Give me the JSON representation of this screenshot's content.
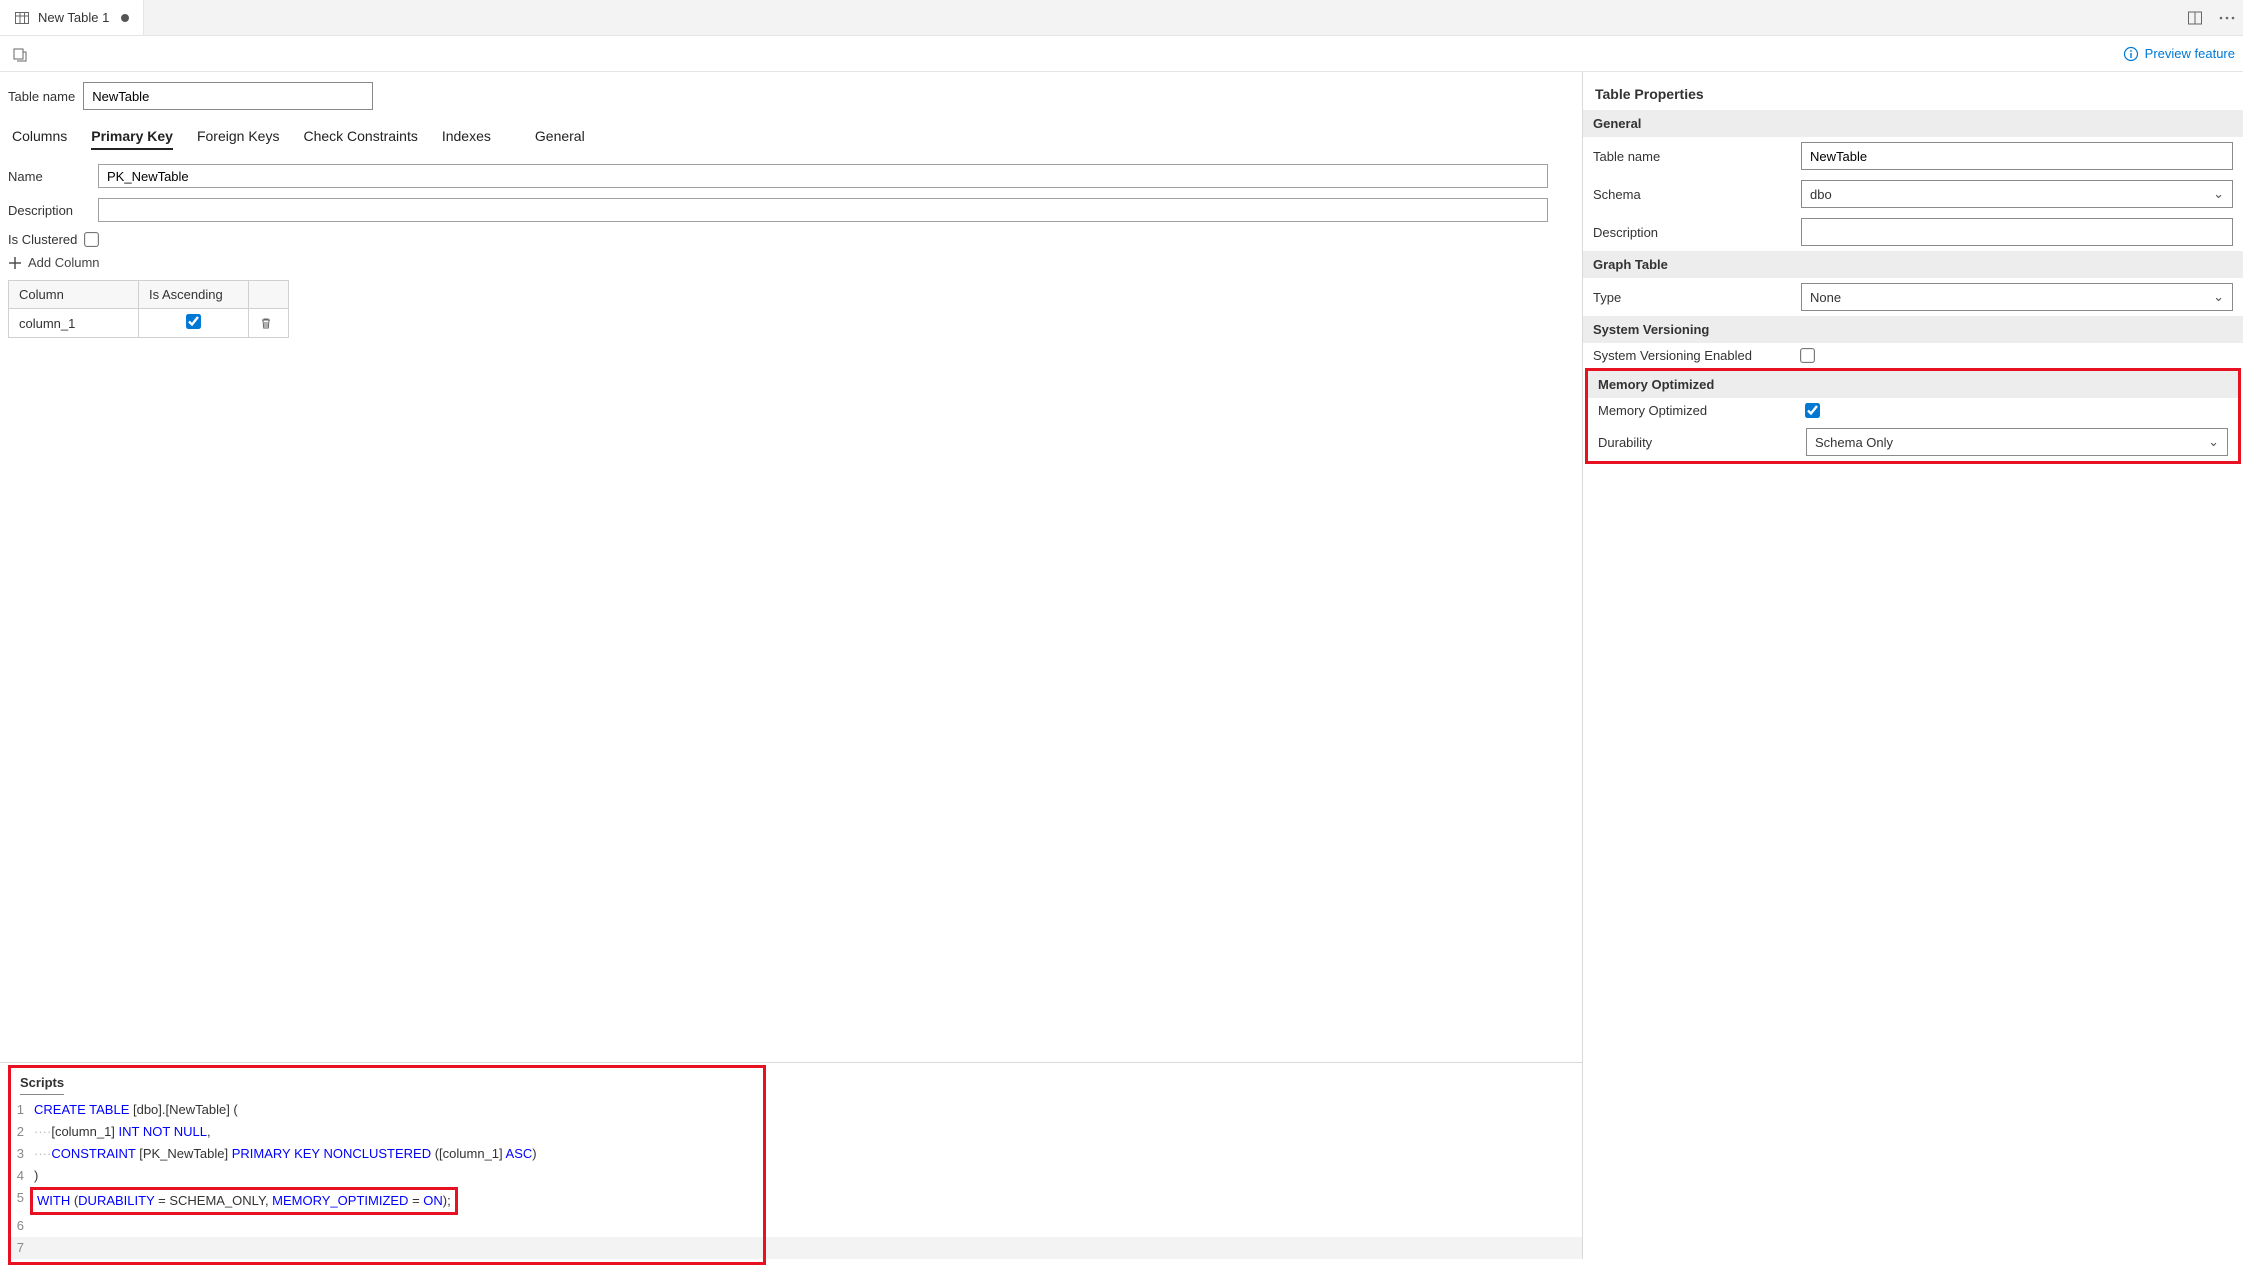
{
  "tab": {
    "title": "New Table 1",
    "modified": true
  },
  "previewLabel": "Preview feature",
  "tableNameLabel": "Table name",
  "tableName": "NewTable",
  "subtabs": {
    "columns": "Columns",
    "primaryKey": "Primary Key",
    "foreignKeys": "Foreign Keys",
    "checkConstraints": "Check Constraints",
    "indexes": "Indexes",
    "general": "General",
    "active": "primaryKey"
  },
  "pk": {
    "nameLabel": "Name",
    "name": "PK_NewTable",
    "descLabel": "Description",
    "desc": "",
    "isClusteredLabel": "Is Clustered",
    "isClustered": false,
    "addColumnLabel": "Add Column",
    "tableHeaders": {
      "col": "Column",
      "asc": "Is Ascending"
    },
    "rows": [
      {
        "column": "column_1",
        "asc": true
      }
    ]
  },
  "scripts": {
    "label": "Scripts",
    "lines": {
      "l1": {
        "kw1": "CREATE",
        "kw2": "TABLE",
        "rest": " [dbo].[NewTable] ("
      },
      "l2": {
        "lead": "····",
        "col": "[column_1] ",
        "t1": "INT",
        "t2": " NOT",
        "t3": " NULL",
        "end": ","
      },
      "l3": {
        "lead": "····",
        "kw": "CONSTRAINT",
        "mid": " [PK_NewTable] ",
        "kw2": "PRIMARY",
        "kw3": " KEY",
        "kw4": " NONCLUSTERED",
        "mid2": " ([column_1] ",
        "kw5": "ASC",
        "end": ")"
      },
      "l4": ")",
      "l5": {
        "kw1": "WITH",
        "mid": " (",
        "kw2": "DURABILITY",
        "mid2": " = SCHEMA_ONLY, ",
        "kw3": "MEMORY_OPTIMIZED",
        "mid3": " = ",
        "kw4": "ON",
        "end": ");"
      }
    }
  },
  "props": {
    "title": "Table Properties",
    "general": {
      "header": "General",
      "tableNameLabel": "Table name",
      "tableName": "NewTable",
      "schemaLabel": "Schema",
      "schema": "dbo",
      "descLabel": "Description",
      "desc": ""
    },
    "graph": {
      "header": "Graph Table",
      "typeLabel": "Type",
      "type": "None"
    },
    "sysver": {
      "header": "System Versioning",
      "enabledLabel": "System Versioning Enabled",
      "enabled": false
    },
    "mem": {
      "header": "Memory Optimized",
      "optLabel": "Memory Optimized",
      "opt": true,
      "durLabel": "Durability",
      "dur": "Schema Only"
    }
  }
}
